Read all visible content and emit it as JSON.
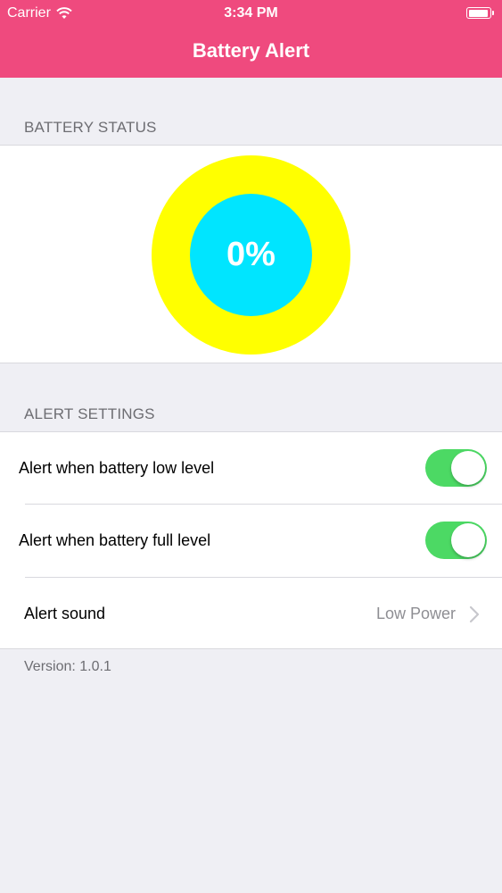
{
  "status_bar": {
    "carrier": "Carrier",
    "time": "3:34 PM"
  },
  "nav": {
    "title": "Battery Alert"
  },
  "battery_status": {
    "header": "BATTERY STATUS",
    "percent_text": "0%",
    "ring_color": "#ffff00",
    "inner_color": "#00e5ff"
  },
  "alert_settings": {
    "header": "ALERT SETTINGS",
    "rows": [
      {
        "label": "Alert when battery low level",
        "toggle_on": true
      },
      {
        "label": "Alert when battery full level",
        "toggle_on": true
      }
    ],
    "sound": {
      "label": "Alert sound",
      "value": "Low Power"
    }
  },
  "footer": {
    "version": "Version: 1.0.1"
  },
  "colors": {
    "accent": "#ef4a7e",
    "toggle_on": "#4cd964"
  },
  "icons": [
    "wifi-icon",
    "battery-icon",
    "chevron-right-icon"
  ]
}
